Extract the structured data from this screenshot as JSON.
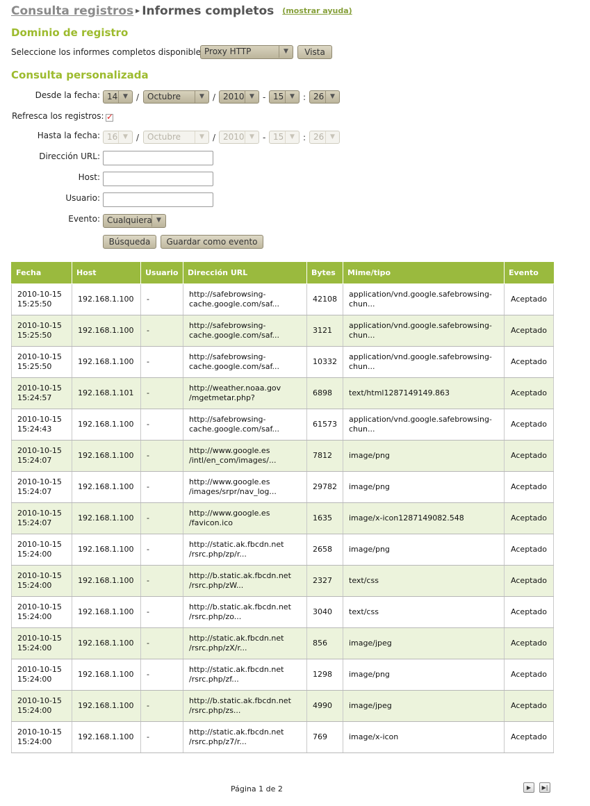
{
  "breadcrumb": {
    "parent": "Consulta registros",
    "separator": "▸",
    "current": "Informes completos",
    "help_link": "(mostrar ayuda)"
  },
  "domain_section": {
    "title": "Dominio de registro",
    "prompt": "Seleccione los informes completos disponibles:",
    "select_value": "Proxy HTTP",
    "view_button": "Vista"
  },
  "custom_query": {
    "title": "Consulta personalizada",
    "from_label": "Desde la fecha:",
    "from": {
      "day": "14",
      "month": "Octubre",
      "year": "2010",
      "hour": "15",
      "minute": "26"
    },
    "refresh_label": "Refresca los registros:",
    "refresh_checked": true,
    "to_label": "Hasta la fecha:",
    "to": {
      "day": "16",
      "month": "Octubre",
      "year": "2010",
      "hour": "15",
      "minute": "26"
    },
    "url_label": "Dirección URL:",
    "url_value": "",
    "host_label": "Host:",
    "host_value": "",
    "user_label": "Usuario:",
    "user_value": "",
    "event_label": "Evento:",
    "event_value": "Cualquiera",
    "search_button": "Búsqueda",
    "save_button": "Guardar como evento",
    "separators": {
      "slash": "/",
      "dash": "-",
      "colon": ":"
    }
  },
  "table": {
    "headers": [
      "Fecha",
      "Host",
      "Usuario",
      "Dirección URL",
      "Bytes",
      "Mime/tipo",
      "Evento"
    ],
    "rows": [
      {
        "date": "2010-10-15",
        "time": "15:25:50",
        "host": "192.168.1.100",
        "user": "-",
        "url1": "http://safebrowsing-",
        "url2": "cache.google.com/saf...",
        "bytes": "42108",
        "mime1": "application/vnd.google.safebrowsing-",
        "mime2": "chun...",
        "event": "Aceptado"
      },
      {
        "date": "2010-10-15",
        "time": "15:25:50",
        "host": "192.168.1.100",
        "user": "-",
        "url1": "http://safebrowsing-",
        "url2": "cache.google.com/saf...",
        "bytes": "3121",
        "mime1": "application/vnd.google.safebrowsing-",
        "mime2": "chun...",
        "event": "Aceptado"
      },
      {
        "date": "2010-10-15",
        "time": "15:25:50",
        "host": "192.168.1.100",
        "user": "-",
        "url1": "http://safebrowsing-",
        "url2": "cache.google.com/saf...",
        "bytes": "10332",
        "mime1": "application/vnd.google.safebrowsing-",
        "mime2": "chun...",
        "event": "Aceptado"
      },
      {
        "date": "2010-10-15",
        "time": "15:24:57",
        "host": "192.168.1.101",
        "user": "-",
        "url1": "http://weather.noaa.gov",
        "url2": "/mgetmetar.php?",
        "bytes": "6898",
        "mime1": "text/html1287149149.863",
        "mime2": "",
        "event": "Aceptado"
      },
      {
        "date": "2010-10-15",
        "time": "15:24:43",
        "host": "192.168.1.100",
        "user": "-",
        "url1": "http://safebrowsing-",
        "url2": "cache.google.com/saf...",
        "bytes": "61573",
        "mime1": "application/vnd.google.safebrowsing-",
        "mime2": "chun...",
        "event": "Aceptado"
      },
      {
        "date": "2010-10-15",
        "time": "15:24:07",
        "host": "192.168.1.100",
        "user": "-",
        "url1": "http://www.google.es",
        "url2": "/intl/en_com/images/...",
        "bytes": "7812",
        "mime1": "image/png",
        "mime2": "",
        "event": "Aceptado"
      },
      {
        "date": "2010-10-15",
        "time": "15:24:07",
        "host": "192.168.1.100",
        "user": "-",
        "url1": "http://www.google.es",
        "url2": "/images/srpr/nav_log...",
        "bytes": "29782",
        "mime1": "image/png",
        "mime2": "",
        "event": "Aceptado"
      },
      {
        "date": "2010-10-15",
        "time": "15:24:07",
        "host": "192.168.1.100",
        "user": "-",
        "url1": "http://www.google.es",
        "url2": "/favicon.ico",
        "bytes": "1635",
        "mime1": "image/x-icon1287149082.548",
        "mime2": "",
        "event": "Aceptado"
      },
      {
        "date": "2010-10-15",
        "time": "15:24:00",
        "host": "192.168.1.100",
        "user": "-",
        "url1": "http://static.ak.fbcdn.net",
        "url2": "/rsrc.php/zp/r...",
        "bytes": "2658",
        "mime1": "image/png",
        "mime2": "",
        "event": "Aceptado"
      },
      {
        "date": "2010-10-15",
        "time": "15:24:00",
        "host": "192.168.1.100",
        "user": "-",
        "url1": "http://b.static.ak.fbcdn.net",
        "url2": "/rsrc.php/zW...",
        "bytes": "2327",
        "mime1": "text/css",
        "mime2": "",
        "event": "Aceptado"
      },
      {
        "date": "2010-10-15",
        "time": "15:24:00",
        "host": "192.168.1.100",
        "user": "-",
        "url1": "http://b.static.ak.fbcdn.net",
        "url2": "/rsrc.php/zo...",
        "bytes": "3040",
        "mime1": "text/css",
        "mime2": "",
        "event": "Aceptado"
      },
      {
        "date": "2010-10-15",
        "time": "15:24:00",
        "host": "192.168.1.100",
        "user": "-",
        "url1": "http://static.ak.fbcdn.net",
        "url2": "/rsrc.php/zX/r...",
        "bytes": "856",
        "mime1": "image/jpeg",
        "mime2": "",
        "event": "Aceptado"
      },
      {
        "date": "2010-10-15",
        "time": "15:24:00",
        "host": "192.168.1.100",
        "user": "-",
        "url1": "http://static.ak.fbcdn.net",
        "url2": "/rsrc.php/zf...",
        "bytes": "1298",
        "mime1": "image/png",
        "mime2": "",
        "event": "Aceptado"
      },
      {
        "date": "2010-10-15",
        "time": "15:24:00",
        "host": "192.168.1.100",
        "user": "-",
        "url1": "http://b.static.ak.fbcdn.net",
        "url2": "/rsrc.php/zs...",
        "bytes": "4990",
        "mime1": "image/jpeg",
        "mime2": "",
        "event": "Aceptado"
      },
      {
        "date": "2010-10-15",
        "time": "15:24:00",
        "host": "192.168.1.100",
        "user": "-",
        "url1": "http://static.ak.fbcdn.net",
        "url2": "/rsrc.php/z7/r...",
        "bytes": "769",
        "mime1": "image/x-icon",
        "mime2": "",
        "event": "Aceptado"
      }
    ]
  },
  "pagination": {
    "label": "Página 1 de 2",
    "next_icon": "next-page-icon",
    "last_icon": "last-page-icon"
  },
  "colors": {
    "accent": "#9dbb2e",
    "header_bg": "#9aba3e",
    "alt_row_bg": "#ecf3dc"
  }
}
